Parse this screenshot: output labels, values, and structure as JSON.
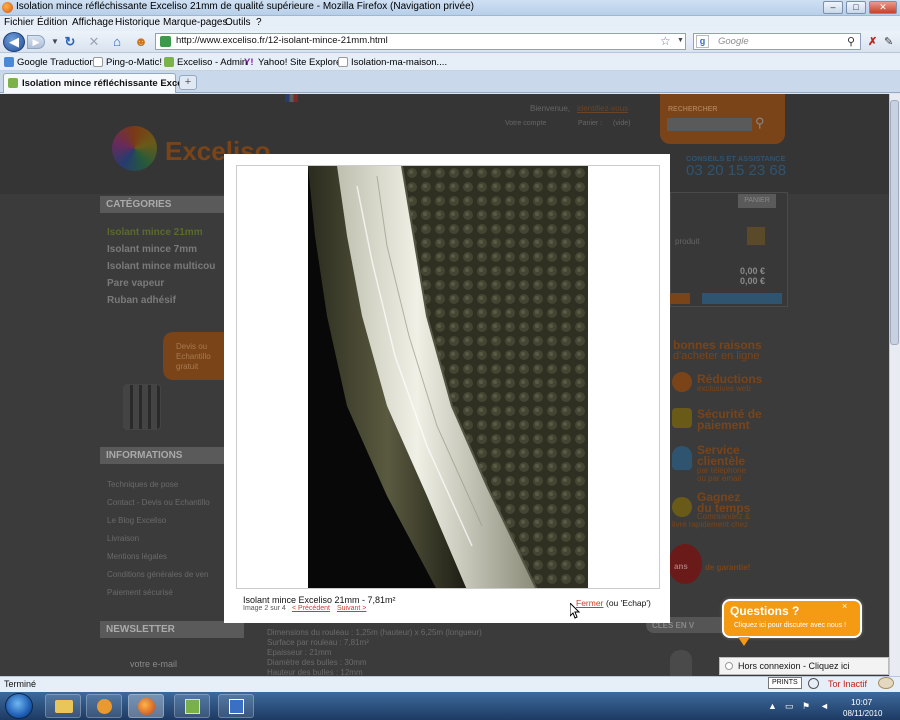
{
  "window": {
    "title": "Isolation mince réfléchissante Exceliso 21mm de qualité supérieure - Mozilla Firefox (Navigation privée)"
  },
  "menubar": {
    "items": [
      "Fichier",
      "Édition",
      "Affichage",
      "Historique",
      "Marque-pages",
      "Outils",
      "?"
    ]
  },
  "navbar": {
    "url": "http://www.exceliso.fr/12-isolant-mince-21mm.html",
    "search_placeholder": "Google"
  },
  "bookmarks": [
    "Google Traduction",
    "Ping-o-Matic!",
    "Exceliso - Admin",
    "Yahoo! Site Explorer",
    "Isolation-ma-maison...."
  ],
  "tab": {
    "label": "Isolation mince réfléchissante Exceli..."
  },
  "page": {
    "header": {
      "welcome": "Bienvenue,",
      "identify": "identifiez-vous",
      "account": "Votre compte",
      "cart": "Panier :",
      "cart_value": "(vide)",
      "search_label": "RECHERCHER",
      "logo": "Exceliso",
      "support": "CONSEILS ET ASSISTANCE",
      "phone": "03 20 15 23 68"
    },
    "categories": {
      "title": "CATÉGORIES",
      "items": [
        "Isolant mince 21mm",
        "Isolant mince 7mm",
        "Isolant mince multicou",
        "Pare vapeur",
        "Ruban adhésif"
      ]
    },
    "quote": {
      "text1": "Devis ou",
      "text2": "Echantillo",
      "text3": "gratuit"
    },
    "information": {
      "title": "INFORMATIONS",
      "items": [
        "Techniques de pose",
        "Contact - Devis ou Echantillo",
        "Le Blog Exceliso",
        "Livraison",
        "Mentions légales",
        "Conditions générales de ven",
        "Paiement sécurisé"
      ]
    },
    "newsletter": {
      "title": "NEWSLETTER",
      "email": "votre e-mail"
    },
    "cartbox": {
      "title": "PANIER",
      "product": "produit",
      "price1": "0,00 €",
      "price2": "0,00 €"
    },
    "reasons": {
      "title1": "bonnes raisons",
      "title2": "d'acheter en ligne",
      "r1": "Réductions",
      "r1sub": "exclusives web",
      "r2a": "Sécurité de",
      "r2b": "paiement",
      "r3a": "Service",
      "r3b": "clientèle",
      "r3c": "par téléphone",
      "r3d": "ou par email",
      "r4a": "Gagnez",
      "r4b": "du temps",
      "r4c": "Commandez &",
      "r4d": "livré rapidement chez",
      "warranty_years": "ans",
      "warranty": "de garantie!"
    },
    "description": [
      "Dimensions du rouleau : 1,25m (hauteur) x 6,25m (longueur)",
      "Surface par rouleau : 7,81m²",
      "Epaisseur : 21mm",
      "Diamètre des bulles : 30mm",
      "Hauteur des bulles : 12mm"
    ],
    "selection_title": "CLES EN V"
  },
  "lightbox": {
    "caption": "Isolant mince Exceliso 21mm - 7,81m²",
    "count": "Image 2 sur 4",
    "prev": "< Précédent",
    "next": "Suivant >",
    "close": "Fermer",
    "close_hint": "(ou 'Echap')"
  },
  "chat": {
    "bubble_title": "Questions ?",
    "bubble_sub": "Cliquez ici pour discuter avec nous !",
    "status": "Hors connexion - Cliquez ici",
    "close": "×"
  },
  "statusbar": {
    "text": "Terminé",
    "prints": "PRINTS",
    "tor": "Tor Inactif"
  },
  "taskbar": {
    "time": "10:07",
    "date": "08/11/2010"
  }
}
